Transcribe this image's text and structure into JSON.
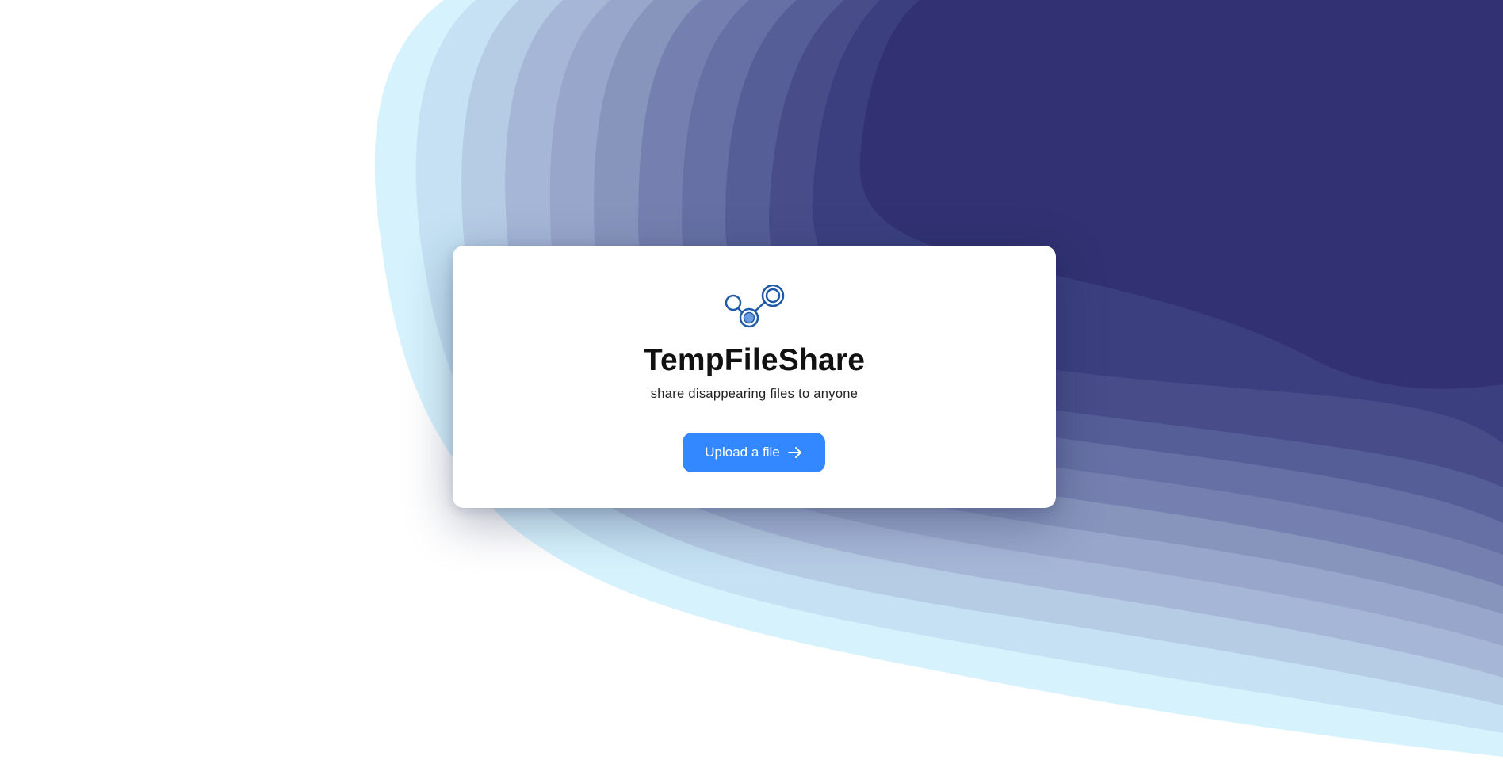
{
  "app": {
    "title": "TempFileShare",
    "tagline": "share disappearing files to anyone"
  },
  "actions": {
    "upload_label": "Upload a file",
    "upload_icon": "arrow-right-icon"
  },
  "logo": {
    "icon": "share-nodes-icon",
    "color": "#1f5aa6",
    "fill": "#6b9be0"
  },
  "theme": {
    "accent": "#3388ff",
    "wave_colors": [
      "#d6f2fd",
      "#c5e1f3",
      "#b6cbe4",
      "#a5b6d7",
      "#97a6ca",
      "#8795bd",
      "#7680b0",
      "#6670a4",
      "#565e97",
      "#484d8a",
      "#3b3f80",
      "#313173"
    ]
  }
}
